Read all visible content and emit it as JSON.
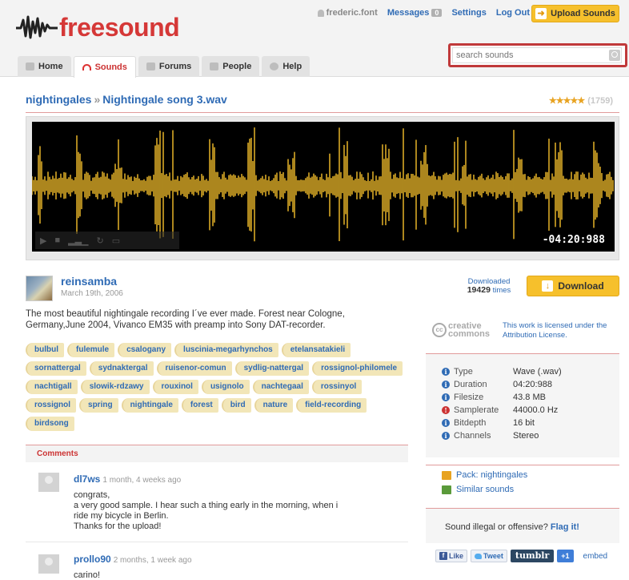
{
  "header": {
    "logo_text": "freesound",
    "username": "frederic.font",
    "messages_label": "Messages",
    "messages_count": "0",
    "settings_label": "Settings",
    "logout_label": "Log Out",
    "upload_label": "Upload Sounds",
    "search_placeholder": "search sounds"
  },
  "nav": {
    "tabs": [
      {
        "label": "Home"
      },
      {
        "label": "Sounds"
      },
      {
        "label": "Forums"
      },
      {
        "label": "People"
      },
      {
        "label": "Help"
      }
    ],
    "active_tab": "Sounds"
  },
  "sound": {
    "pack": "nightingales",
    "separator": "»",
    "title": "Nightingale song 3.wav",
    "rating_count": "(1759)",
    "rating_stars": 4.5,
    "time_display": "-04:20:988",
    "author": "reinsamba",
    "date": "March 19th, 2006",
    "description": "The most beautiful nightingale recording I´ve ever made. Forest near Cologne, Germany,June 2004, Vivanco EM35 with preamp into Sony DAT-recorder.",
    "downloaded_label": "Downloaded",
    "downloaded_count": "19429",
    "downloaded_times": "times",
    "download_label": "Download"
  },
  "tags": [
    [
      "bulbul",
      "fulemule",
      "csalogany",
      "luscinia-megarhynchos",
      "etelansatakieli"
    ],
    [
      "sornattergal",
      "sydnaktergal",
      "ruisenor-comun",
      "sydlig-nattergal",
      "rossignol-philomele"
    ],
    [
      "nachtigall",
      "slowik-rdzawy",
      "rouxinol",
      "usignolo",
      "nachtegaal",
      "rossinyol"
    ],
    [
      "rossignol",
      "spring",
      "nightingale",
      "forest",
      "bird",
      "nature",
      "field-recording"
    ],
    [
      "birdsong"
    ]
  ],
  "license": {
    "cc_word1": "creative",
    "cc_word2": "commons",
    "text": "This work is licensed under the Attribution License."
  },
  "metadata": [
    {
      "label": "Type",
      "value": "Wave (.wav)",
      "icon": "info-icon"
    },
    {
      "label": "Duration",
      "value": "04:20:988",
      "icon": "info-icon"
    },
    {
      "label": "Filesize",
      "value": "43.8 MB",
      "icon": "info-icon"
    },
    {
      "label": "Samplerate",
      "value": "44000.0 Hz",
      "icon": "warning-icon"
    },
    {
      "label": "Bitdepth",
      "value": "16 bit",
      "icon": "info-icon"
    },
    {
      "label": "Channels",
      "value": "Stereo",
      "icon": "info-icon"
    }
  ],
  "links": {
    "pack": "Pack: nightingales",
    "similar": "Similar sounds"
  },
  "flag": {
    "question": "Sound illegal or offensive?",
    "link": "Flag it!"
  },
  "share": {
    "like": "Like",
    "tweet": "Tweet",
    "tumblr": "tumblr",
    "plusone": "+1",
    "embed": "embed"
  },
  "comments": {
    "header": "Comments",
    "items": [
      {
        "user": "dl7ws",
        "time": "1 month, 4 weeks ago",
        "text": "congrats,\na very good sample. I hear such a thing early in the morning, when i\nride my bicycle in Berlin.\nThanks for the upload!"
      },
      {
        "user": "prollo90",
        "time": "2 months, 1 week ago",
        "text": "carino!"
      }
    ]
  },
  "colors": {
    "brand_red": "#d53837",
    "link_blue": "#2f6bb5",
    "accent_yellow": "#f6c02c",
    "waveform": "#f6c02c"
  }
}
